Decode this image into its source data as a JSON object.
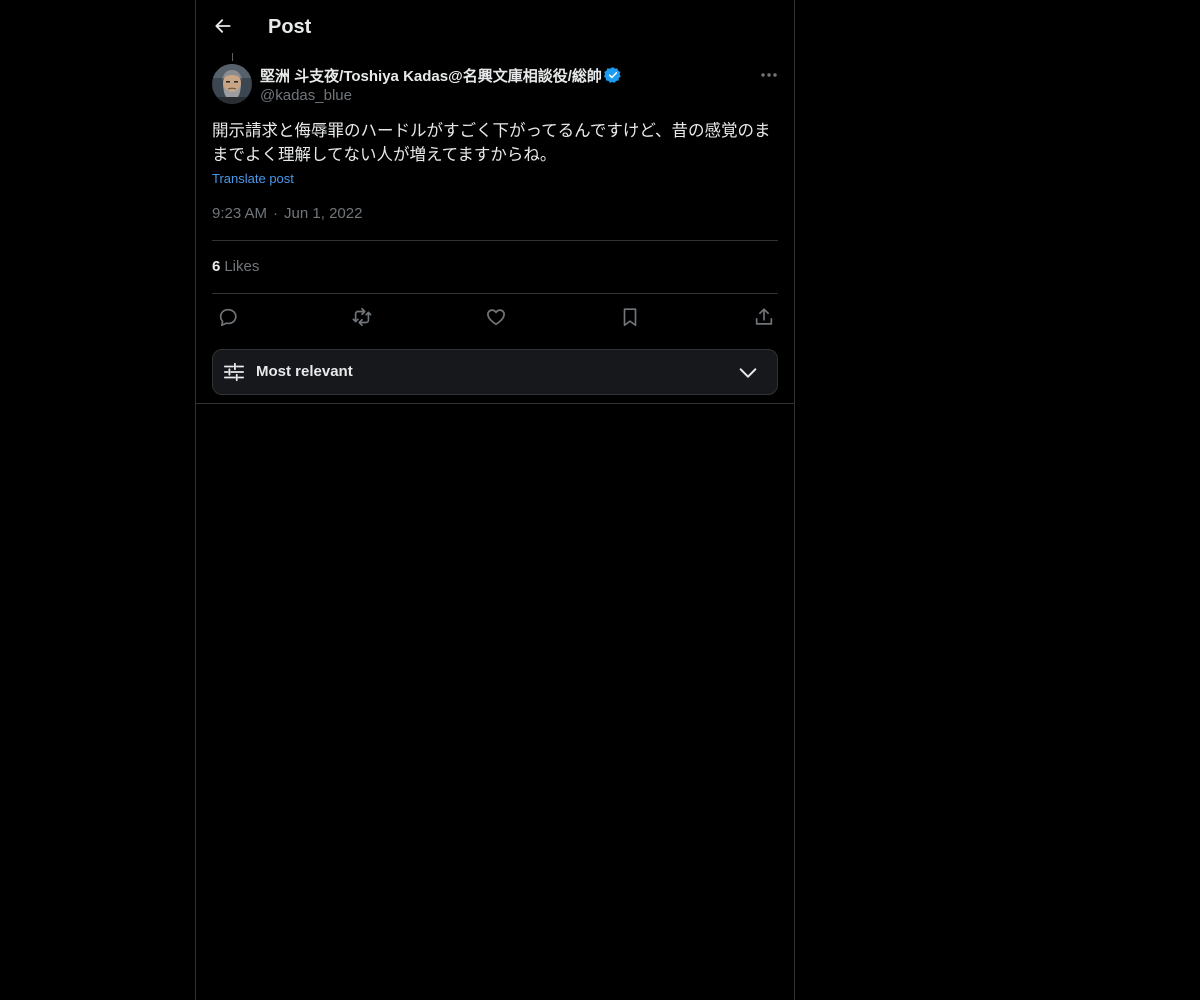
{
  "header": {
    "title": "Post",
    "back_icon": "arrow-left-icon"
  },
  "post": {
    "author": {
      "name": "堅洲 斗支夜/Toshiya Kadas@名興文庫相談役/総帥",
      "handle": "@kadas_blue",
      "verified": true,
      "verified_color": "#1d9bf0"
    },
    "text": "開示請求と侮辱罪のハードルがすごく下がってるんですけど、昔の感覚のままでよく理解してない人が増えてますからね。",
    "translate_label": "Translate post",
    "time": "9:23 AM",
    "separator": "·",
    "date": "Jun 1, 2022",
    "likes_count": "6",
    "likes_label": "Likes"
  },
  "actions": [
    {
      "name": "reply",
      "icon": "reply-icon"
    },
    {
      "name": "repost",
      "icon": "repost-icon"
    },
    {
      "name": "like",
      "icon": "heart-icon"
    },
    {
      "name": "bookmark",
      "icon": "bookmark-icon"
    },
    {
      "name": "share",
      "icon": "share-icon"
    }
  ],
  "sort": {
    "label": "Most relevant",
    "icon": "sliders-icon",
    "chevron": "chevron-down-icon"
  },
  "colors": {
    "background": "#000000",
    "text": "#e7e9ea",
    "muted": "#71767b",
    "link": "#4a99e9",
    "border": "#2f3336"
  }
}
